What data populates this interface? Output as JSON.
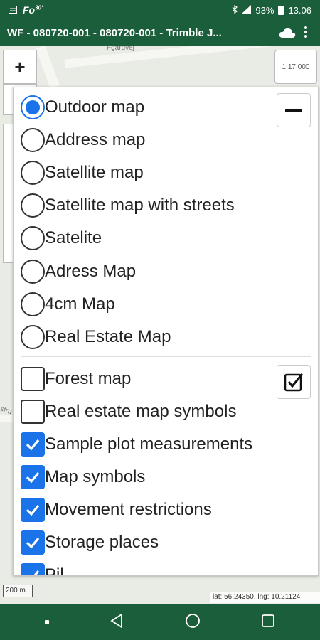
{
  "status_bar": {
    "app_badge": "Fo",
    "app_badge_sup": "30°",
    "battery": "93%",
    "time": "13.06"
  },
  "app_bar": {
    "title": "WF - 080720-001 - 080720-001 - Trimble J...",
    "icons": [
      "cloud-icon",
      "more-vert-icon"
    ]
  },
  "map": {
    "zoom_in_label": "+",
    "scale_ratio": "1:17 000",
    "scale_bar": "200 m",
    "coordinates": "lat: 56.24350, lng: 10.21124",
    "street_fragments": [
      "Fgardvej",
      "stru"
    ]
  },
  "layers_panel": {
    "collapse_icon": "minus-icon",
    "toggle_all_icon": "checkbox-checked-icon",
    "base_maps": [
      {
        "label": "Outdoor map",
        "selected": true
      },
      {
        "label": "Address map",
        "selected": false
      },
      {
        "label": "Satellite map",
        "selected": false
      },
      {
        "label": "Satellite map with streets",
        "selected": false
      },
      {
        "label": "Satelite",
        "selected": false
      },
      {
        "label": "Adress Map",
        "selected": false
      },
      {
        "label": "4cm Map",
        "selected": false
      },
      {
        "label": "Real Estate Map",
        "selected": false
      }
    ],
    "overlays": [
      {
        "label": "Forest map",
        "checked": false
      },
      {
        "label": "Real estate map symbols",
        "checked": false
      },
      {
        "label": "Sample plot measurements",
        "checked": true
      },
      {
        "label": "Map symbols",
        "checked": true
      },
      {
        "label": "Movement restrictions",
        "checked": true
      },
      {
        "label": "Storage places",
        "checked": true
      },
      {
        "label": "Pil",
        "checked": true
      }
    ]
  },
  "colors": {
    "header": "#1b5e3b",
    "accent": "#1a73e8"
  },
  "nav_bar": {
    "icons": [
      "nav-dot-icon",
      "back-icon",
      "home-icon",
      "recents-icon"
    ]
  }
}
